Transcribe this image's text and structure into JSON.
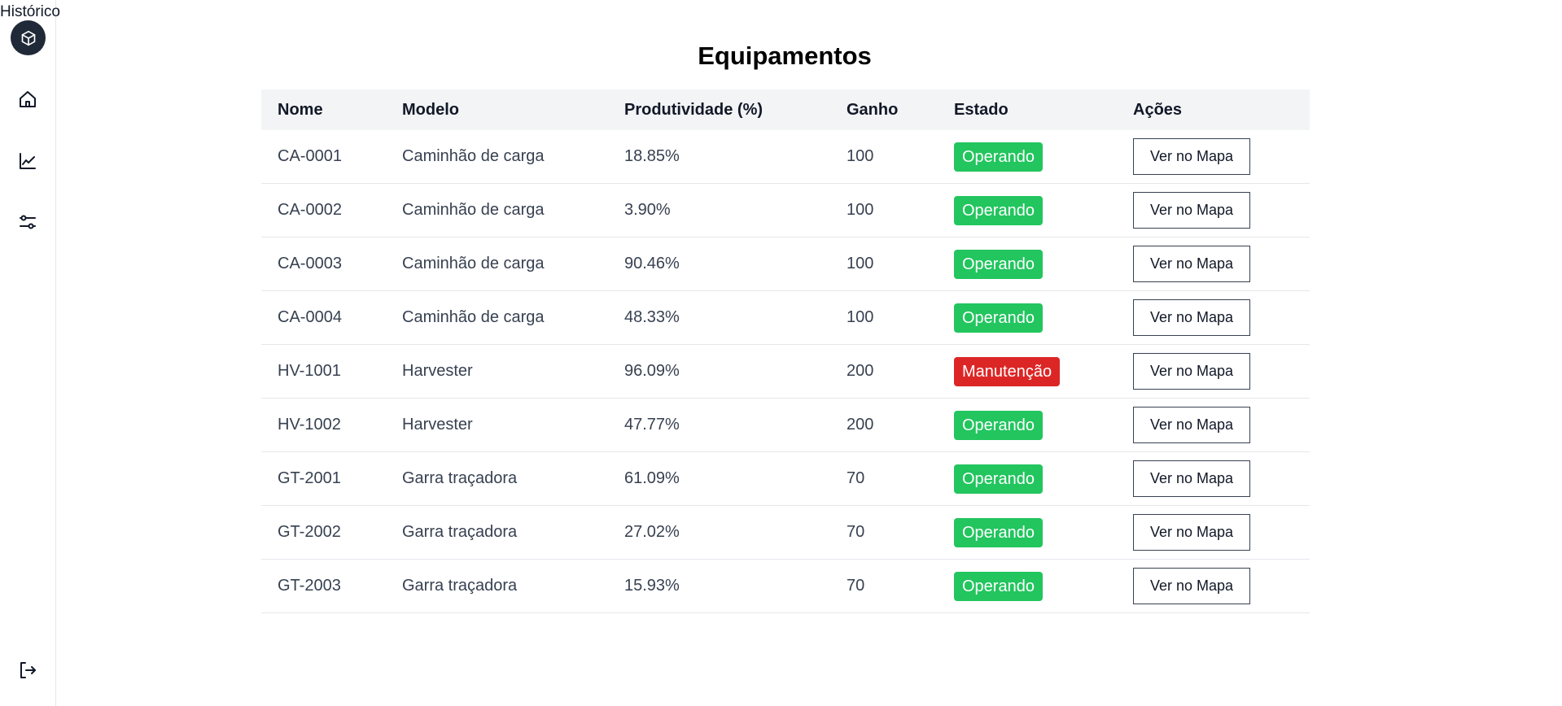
{
  "floating_label": "Histórico",
  "page_title": "Equipamentos",
  "sidebar": {
    "logo_icon": "cube-icon",
    "items": [
      {
        "icon": "home-icon"
      },
      {
        "icon": "chart-line-icon"
      },
      {
        "icon": "sliders-icon"
      }
    ],
    "logout_icon": "logout-icon"
  },
  "table": {
    "headers": {
      "nome": "Nome",
      "modelo": "Modelo",
      "produtividade": "Produtividade (%)",
      "ganho": "Ganho",
      "estado": "Estado",
      "acoes": "Ações"
    },
    "rows": [
      {
        "nome": "CA-0001",
        "modelo": "Caminhão de carga",
        "produtividade": "18.85%",
        "ganho": "100",
        "estado": "Operando",
        "acao": "Ver no Mapa"
      },
      {
        "nome": "CA-0002",
        "modelo": "Caminhão de carga",
        "produtividade": "3.90%",
        "ganho": "100",
        "estado": "Operando",
        "acao": "Ver no Mapa"
      },
      {
        "nome": "CA-0003",
        "modelo": "Caminhão de carga",
        "produtividade": "90.46%",
        "ganho": "100",
        "estado": "Operando",
        "acao": "Ver no Mapa"
      },
      {
        "nome": "CA-0004",
        "modelo": "Caminhão de carga",
        "produtividade": "48.33%",
        "ganho": "100",
        "estado": "Operando",
        "acao": "Ver no Mapa"
      },
      {
        "nome": "HV-1001",
        "modelo": "Harvester",
        "produtividade": "96.09%",
        "ganho": "200",
        "estado": "Manutenção",
        "acao": "Ver no Mapa"
      },
      {
        "nome": "HV-1002",
        "modelo": "Harvester",
        "produtividade": "47.77%",
        "ganho": "200",
        "estado": "Operando",
        "acao": "Ver no Mapa"
      },
      {
        "nome": "GT-2001",
        "modelo": "Garra traçadora",
        "produtividade": "61.09%",
        "ganho": "70",
        "estado": "Operando",
        "acao": "Ver no Mapa"
      },
      {
        "nome": "GT-2002",
        "modelo": "Garra traçadora",
        "produtividade": "27.02%",
        "ganho": "70",
        "estado": "Operando",
        "acao": "Ver no Mapa"
      },
      {
        "nome": "GT-2003",
        "modelo": "Garra traçadora",
        "produtividade": "15.93%",
        "ganho": "70",
        "estado": "Operando",
        "acao": "Ver no Mapa"
      }
    ]
  },
  "status_colors": {
    "Operando": "#22c55e",
    "Manutenção": "#dc2626"
  }
}
